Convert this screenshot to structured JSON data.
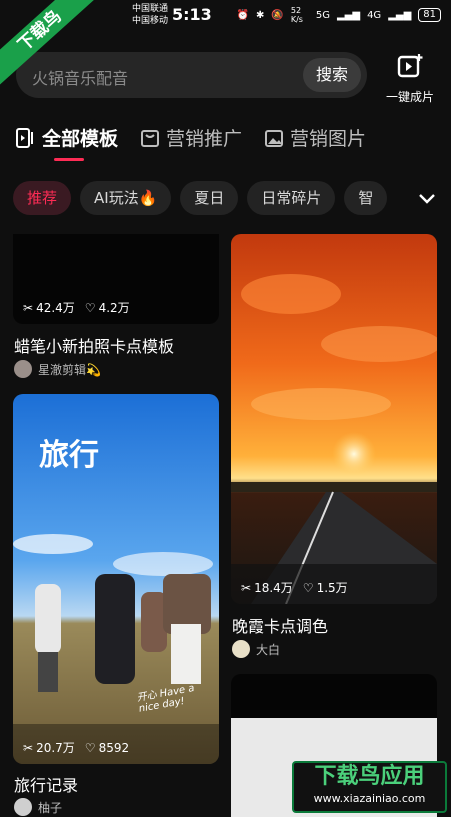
{
  "status_bar": {
    "carrier1": "中国联通",
    "carrier2": "中国移动",
    "time": "5:13",
    "net_speed": "52 K/s",
    "net_5g": "5G",
    "net_4g": "4G",
    "battery": "81"
  },
  "ribbon": {
    "text": "下载鸟"
  },
  "search": {
    "placeholder": "火锅音乐配音",
    "button": "搜索"
  },
  "one_click": {
    "label": "一键成片",
    "icon": "video-add-icon"
  },
  "tabs": [
    {
      "label": "全部模板",
      "active": true,
      "icon": "template-icon"
    },
    {
      "label": "营销推广",
      "active": false,
      "icon": "bag-icon"
    },
    {
      "label": "营销图片",
      "active": false,
      "icon": "image-icon"
    }
  ],
  "chips": [
    {
      "label": "推荐",
      "active": true
    },
    {
      "label": "AI玩法🔥",
      "active": false
    },
    {
      "label": "夏日",
      "active": false
    },
    {
      "label": "日常碎片",
      "active": false
    },
    {
      "label": "智",
      "active": false
    }
  ],
  "cards": [
    {
      "title": "蜡笔小新拍照卡点模板",
      "uses": "42.4万",
      "likes": "4.2万",
      "author": "星澈剪辑💫"
    },
    {
      "title": "晚霞卡点调色",
      "uses": "18.4万",
      "likes": "1.5万",
      "author": "大白"
    },
    {
      "title": "旅行记录",
      "uses": "20.7万",
      "likes": "8592",
      "author": "柚子",
      "overlay_title": "旅行",
      "overlay_caption": "开心 Have a nice day!"
    }
  ],
  "watermark": {
    "title": "下载鸟应用",
    "url": "www.xiazainiao.com"
  },
  "colors": {
    "accent": "#fe2c55",
    "background": "#0f0f0f",
    "watermark_green": "#1aa04a"
  }
}
